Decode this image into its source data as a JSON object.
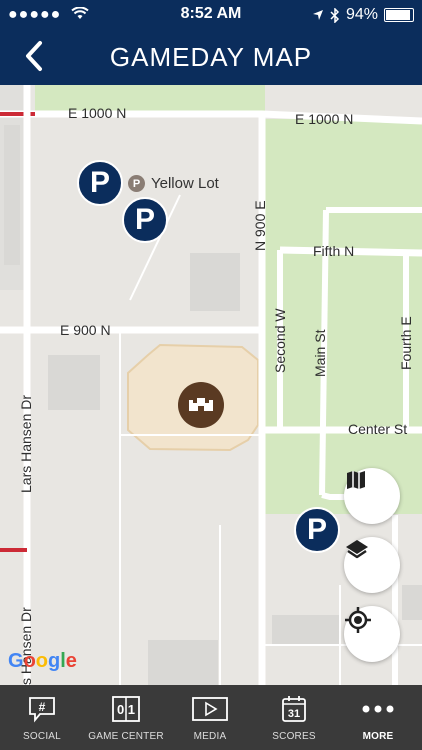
{
  "status_bar": {
    "signal": "●●●●●",
    "time": "8:52 AM",
    "battery": "94%",
    "battery_level": 0.94
  },
  "header": {
    "title": "GAMEDAY MAP"
  },
  "map": {
    "streets": {
      "e1000n_left": "E 1000 N",
      "e1000n_right": "E 1000 N",
      "n900e": "N 900 E",
      "fifth_n": "Fifth N",
      "e900n": "E 900 N",
      "second_w": "Second W",
      "main_st": "Main St",
      "fourth_e": "Fourth E",
      "center_st": "Center St",
      "lars_hansen_upper": "Lars Hansen Dr",
      "lars_hansen_lower": "s Hansen Dr"
    },
    "poi_label": "Yellow Lot",
    "parking_marker": "P",
    "attribution": "Google"
  },
  "tabs": [
    {
      "label": "SOCIAL",
      "icon": "social-hashtag-icon",
      "glyph": "#"
    },
    {
      "label": "GAME CENTER",
      "icon": "game-center-scoreboard-icon",
      "glyph": "0 1"
    },
    {
      "label": "MEDIA",
      "icon": "media-play-icon"
    },
    {
      "label": "SCORES",
      "icon": "scores-calendar-icon",
      "glyph": "31"
    },
    {
      "label": "MORE",
      "icon": "more-dots-icon",
      "active": true
    }
  ]
}
